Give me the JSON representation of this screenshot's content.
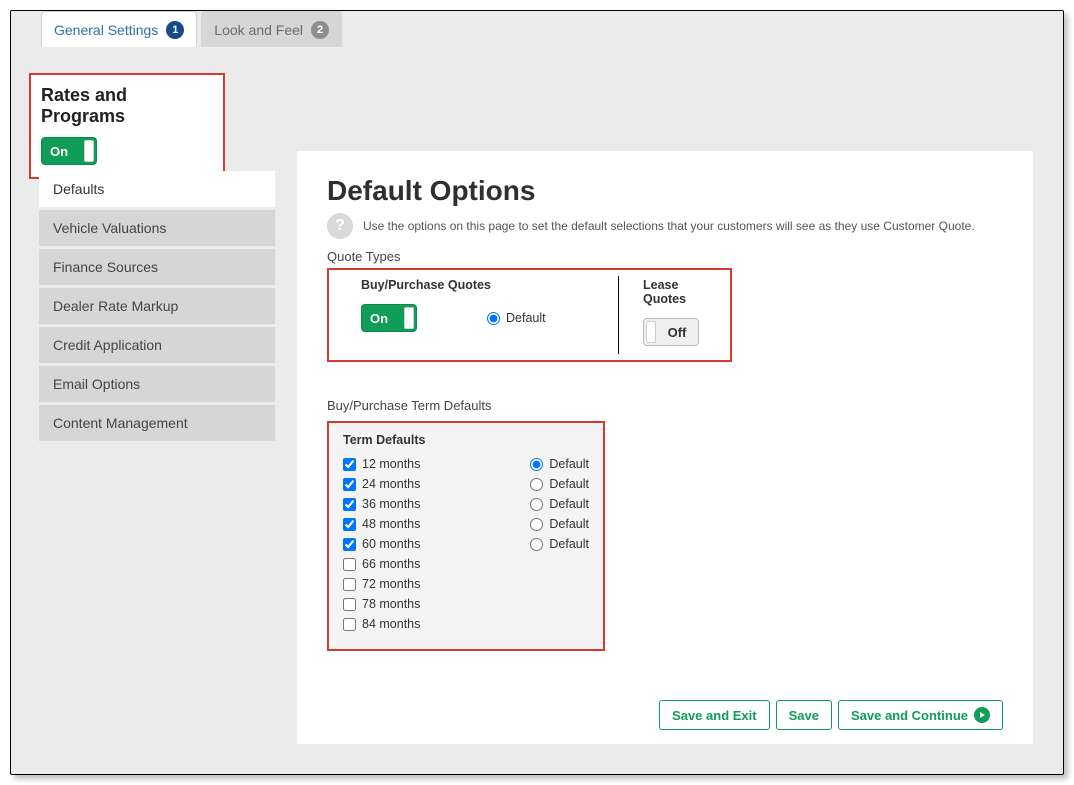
{
  "tabs": [
    {
      "label": "General Settings",
      "badge": "1",
      "active": true
    },
    {
      "label": "Look and Feel",
      "badge": "2",
      "active": false
    }
  ],
  "rates_programs": {
    "title": "Rates and Programs",
    "toggle_label": "On"
  },
  "sidebar": {
    "items": [
      {
        "label": "Defaults",
        "active": true
      },
      {
        "label": "Vehicle Valuations",
        "active": false
      },
      {
        "label": "Finance Sources",
        "active": false
      },
      {
        "label": "Dealer Rate Markup",
        "active": false
      },
      {
        "label": "Credit Application",
        "active": false
      },
      {
        "label": "Email Options",
        "active": false
      },
      {
        "label": "Content Management",
        "active": false
      }
    ]
  },
  "main": {
    "heading": "Default Options",
    "help_text": "Use the options on this page to set the default selections that your customers will see as they use Customer Quote.",
    "quote_types_label": "Quote Types",
    "quote_types": {
      "buy": {
        "title": "Buy/Purchase Quotes",
        "toggle_label": "On",
        "radio_label": "Default",
        "radio_checked": true
      },
      "lease": {
        "title": "Lease Quotes",
        "toggle_label": "Off"
      }
    },
    "term_defaults_label": "Buy/Purchase Term Defaults",
    "term_box_title": "Term Defaults",
    "terms": [
      {
        "label": "12 months",
        "checked": true,
        "has_default": true,
        "default_selected": true,
        "default_label": "Default"
      },
      {
        "label": "24 months",
        "checked": true,
        "has_default": true,
        "default_selected": false,
        "default_label": "Default"
      },
      {
        "label": "36 months",
        "checked": true,
        "has_default": true,
        "default_selected": false,
        "default_label": "Default"
      },
      {
        "label": "48 months",
        "checked": true,
        "has_default": true,
        "default_selected": false,
        "default_label": "Default"
      },
      {
        "label": "60 months",
        "checked": true,
        "has_default": true,
        "default_selected": false,
        "default_label": "Default"
      },
      {
        "label": "66 months",
        "checked": false,
        "has_default": false
      },
      {
        "label": "72 months",
        "checked": false,
        "has_default": false
      },
      {
        "label": "78 months",
        "checked": false,
        "has_default": false
      },
      {
        "label": "84 months",
        "checked": false,
        "has_default": false
      }
    ],
    "buttons": {
      "save_exit": "Save and Exit",
      "save": "Save",
      "save_continue": "Save and Continue"
    }
  }
}
